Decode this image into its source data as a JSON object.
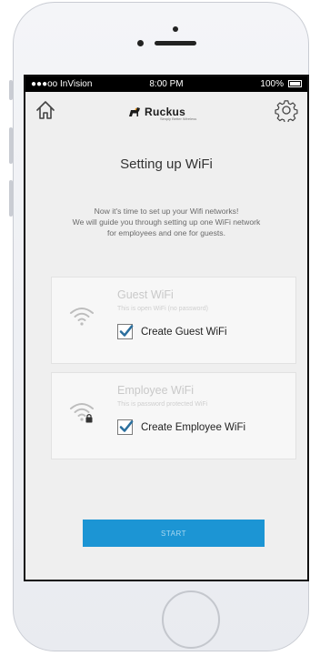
{
  "status_bar": {
    "carrier": "●●●oo InVision",
    "time": "8:00 PM",
    "battery": "100%"
  },
  "header": {
    "logo_text": "Ruckus",
    "logo_subtext": "Simply Better Wireless"
  },
  "page": {
    "title": "Setting up WiFi",
    "intro_lines": [
      "Now it's time to set up your Wifi networks!",
      "We will guide you through setting up one WiFi network",
      "for employees and one for guests."
    ]
  },
  "networks": [
    {
      "name": "Guest WiFi",
      "description": "This is open WiFi (no password)",
      "checkbox_label": "Create Guest WiFi",
      "checked": true,
      "icon": "wifi-icon"
    },
    {
      "name": "Employee WiFi",
      "description": "This is password protected WiFi",
      "checkbox_label": "Create Employee WiFi",
      "checked": true,
      "icon": "wifi-lock-icon"
    }
  ],
  "actions": {
    "start_label": "START"
  },
  "colors": {
    "accent": "#1c95d4",
    "check": "#2b6f9e"
  }
}
